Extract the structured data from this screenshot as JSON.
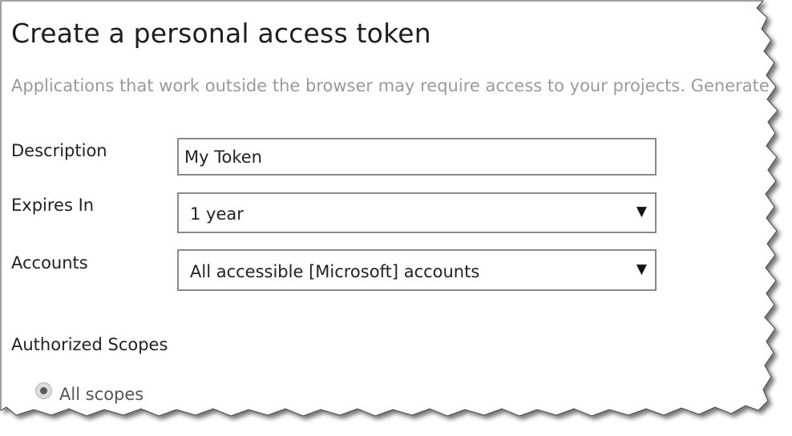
{
  "page": {
    "title": "Create a personal access token",
    "subtitle": "Applications that work outside the browser may require access to your projects. Generate"
  },
  "form": {
    "description": {
      "label": "Description",
      "value": "My Token"
    },
    "expires": {
      "label": "Expires In",
      "value": "1 year",
      "arrow": "▼"
    },
    "accounts": {
      "label": "Accounts",
      "value": "All accessible [Microsoft] accounts",
      "arrow": "▼"
    }
  },
  "scopes": {
    "heading": "Authorized Scopes",
    "option_all": {
      "label": "All scopes",
      "selected": true
    }
  },
  "icons": {
    "dropdown": "chevron-down-icon"
  }
}
